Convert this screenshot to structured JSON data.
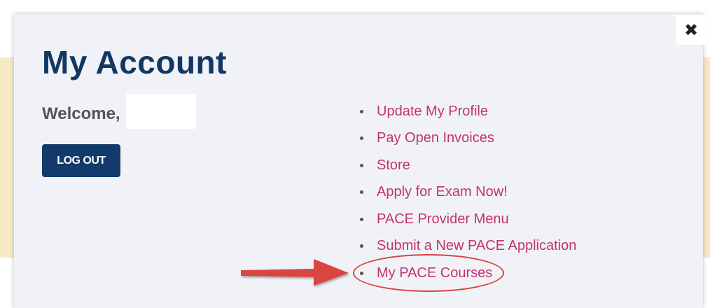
{
  "modal": {
    "title": "My Account",
    "close_icon": "close-icon",
    "close_label": "✖",
    "welcome_text": "Welcome,",
    "logout_label": "LOG OUT",
    "links": [
      {
        "label": "Update My Profile"
      },
      {
        "label": "Pay Open Invoices"
      },
      {
        "label": "Store"
      },
      {
        "label": "Apply for Exam Now!"
      },
      {
        "label": "PACE Provider Menu"
      },
      {
        "label": "Submit a New PACE Application"
      },
      {
        "label": "My PACE Courses"
      }
    ],
    "highlighted_link": "My PACE Courses"
  },
  "colors": {
    "title": "#123763",
    "logout_bg": "#123a6a",
    "link": "#c2336e",
    "annotation": "#d9443f",
    "backdrop_band": "#f8e9c6",
    "modal_bg": "#f1f2f7"
  }
}
